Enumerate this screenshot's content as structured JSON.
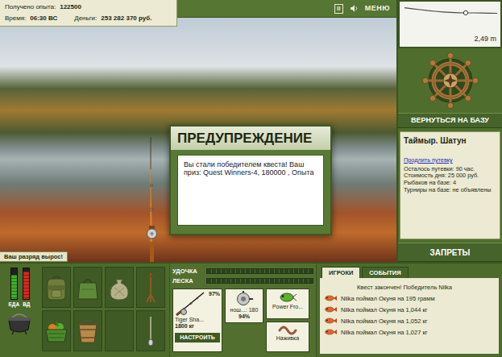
{
  "hud": {
    "experience_label": "Получено опыта:",
    "experience": "122500",
    "time_label": "Время:",
    "time": "06:30 ВС",
    "money_label": "Деньги:",
    "money": "253 282 370 руб."
  },
  "toolbar": {
    "pause": "II",
    "menu": "МЕНЮ"
  },
  "depth": {
    "reading": "2,49 m",
    "values": [
      0.9,
      1.2,
      1.5,
      1.8,
      2.0,
      2.2,
      2.35,
      2.45,
      2.49,
      2.5,
      2.55,
      2.6,
      2.62
    ],
    "float_level": 0.66
  },
  "dialog": {
    "title": "ПРЕДУПРЕЖДЕНИЕ",
    "message": "Вы стали победителем квеста! Ваш приз: Quest Winners-4, 180000 , Опыта"
  },
  "rank_badge": "Ваш разряд вырос!",
  "base": {
    "return_button": "ВЕРНУТЬСЯ НА БАЗУ",
    "location": "Таймыр. Шатун",
    "extend_link": "Продлить путевку",
    "details": [
      "Осталось путевки: 90 час.",
      "Стоимость дня: 25 000 руб.",
      "Рыбаков на базе: 4",
      "Турниры на базе: не объявлены"
    ],
    "bans_button": "ЗАПРЕТЫ"
  },
  "needs": [
    {
      "label": "ЕДА",
      "level": 0.8,
      "color": "#3fae2a"
    },
    {
      "label": "ВД",
      "level": 0.9,
      "color": "#d8281e"
    }
  ],
  "inventory": [
    {
      "kind": "backpack"
    },
    {
      "kind": "bag"
    },
    {
      "kind": "sack"
    },
    {
      "kind": "stand"
    },
    {
      "kind": "basket"
    },
    {
      "kind": "bucket"
    },
    {
      "kind": "empty"
    },
    {
      "kind": "spinner"
    }
  ],
  "tension": [
    {
      "label": "УДОЧКА",
      "level": 0
    },
    {
      "label": "ЛЕСКА",
      "level": 0
    }
  ],
  "tackle": {
    "rod": {
      "name": "Tiger Sha...",
      "strength": "1800 кг",
      "wear": "97%"
    },
    "reel": {
      "name": "нош...: 180",
      "wear": "94%"
    },
    "lure": {
      "name": "Power Fro..."
    },
    "bait": {
      "name": "Наживка"
    },
    "setup_button": "НАСТРОИТЬ"
  },
  "chat": {
    "tabs": [
      {
        "label": "ИГРОКИ",
        "selected": true
      },
      {
        "label": "СОБЫТИЯ",
        "selected": false
      }
    ],
    "messages": [
      {
        "text": "Квест закончен! Победитель Nilka",
        "kind": "notice"
      },
      {
        "text": "Nilka поймал Окуня на 195 грамм",
        "kind": "catch"
      },
      {
        "text": "Nilka поймал Окуня на 1,044 кг",
        "kind": "catch"
      },
      {
        "text": "Nilka поймал Окуня на 1,052 кг",
        "kind": "catch"
      },
      {
        "text": "Nilka поймал Окуня на 1,027 кг",
        "kind": "catch"
      }
    ]
  }
}
